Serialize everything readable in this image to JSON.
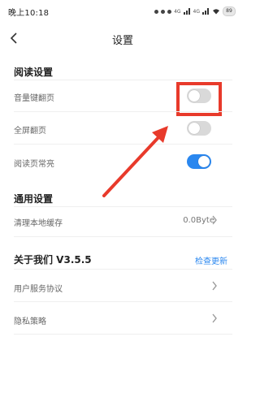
{
  "status_bar": {
    "time": "晚上10:18",
    "net_label_1": "4G",
    "net_label_2": "4G",
    "battery": "89"
  },
  "header": {
    "title": "设置"
  },
  "reading": {
    "section_title": "阅读设置",
    "volume_keys_label": "音量键翻页",
    "volume_keys_on": false,
    "fullscreen_label": "全屏翻页",
    "fullscreen_on": false,
    "keep_on_label": "阅读页常亮",
    "keep_on_on": true
  },
  "general": {
    "section_title": "通用设置",
    "clear_cache_label": "清理本地缓存",
    "cache_size": "0.0Byte"
  },
  "about": {
    "title": "关于我们  V3.5.5",
    "check_update": "检查更新",
    "user_agreement": "用户服务协议",
    "privacy_policy": "隐私策略"
  },
  "colors": {
    "accent": "#2a87ef",
    "annotation_red": "#e83a2b",
    "toggle_off": "#d9d9d9"
  },
  "icons": [
    "back-arrow-icon",
    "chevron-right-icon"
  ]
}
